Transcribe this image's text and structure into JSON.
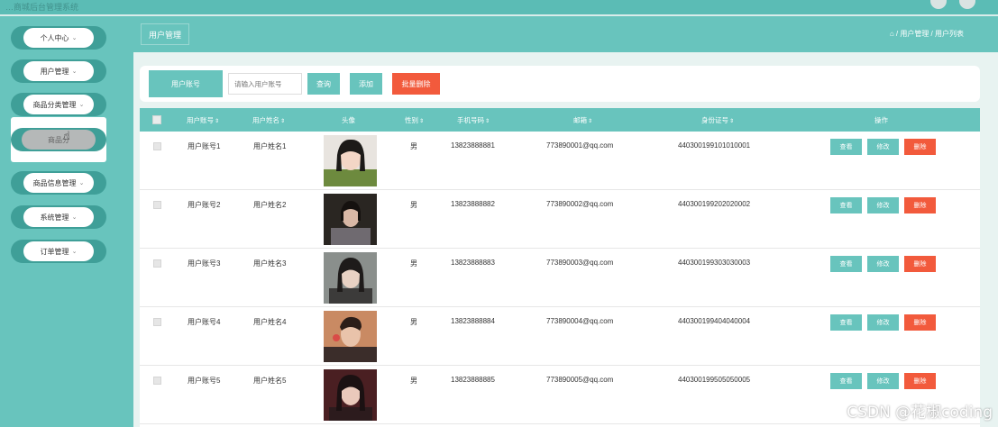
{
  "window": {
    "title": "…商城后台管理系统"
  },
  "sidebar": {
    "items": [
      {
        "label": "个人中心"
      },
      {
        "label": "用户管理"
      },
      {
        "label": "商品分类管理"
      },
      {
        "label": "商品信息管理"
      },
      {
        "label": "系统管理"
      },
      {
        "label": "订单管理"
      }
    ],
    "submenu": {
      "label": "商品分"
    }
  },
  "header": {
    "tab": "用户管理",
    "breadcrumb": "⌂ / 用户管理 / 用户列表"
  },
  "search": {
    "field_label": "用户账号",
    "placeholder": "请输入用户账号",
    "query_button": "查询",
    "add_button": "添加",
    "batch_delete_button": "批量删除"
  },
  "table": {
    "columns": [
      "用户账号",
      "用户姓名",
      "头像",
      "性别",
      "手机号码",
      "邮箱",
      "身份证号",
      "操作"
    ],
    "rows": [
      {
        "account": "用户账号1",
        "name": "用户姓名1",
        "gender": "男",
        "phone": "13823888881",
        "email": "773890001@qq.com",
        "id_card": "440300199101010001"
      },
      {
        "account": "用户账号2",
        "name": "用户姓名2",
        "gender": "男",
        "phone": "13823888882",
        "email": "773890002@qq.com",
        "id_card": "440300199202020002"
      },
      {
        "account": "用户账号3",
        "name": "用户姓名3",
        "gender": "男",
        "phone": "13823888883",
        "email": "773890003@qq.com",
        "id_card": "440300199303030003"
      },
      {
        "account": "用户账号4",
        "name": "用户姓名4",
        "gender": "男",
        "phone": "13823888884",
        "email": "773890004@qq.com",
        "id_card": "440300199404040004"
      },
      {
        "account": "用户账号5",
        "name": "用户姓名5",
        "gender": "男",
        "phone": "13823888885",
        "email": "773890005@qq.com",
        "id_card": "440300199505050005"
      }
    ],
    "actions": {
      "view": "查看",
      "edit": "修改",
      "delete": "删除"
    }
  },
  "watermark": "CSDN @花椒coding",
  "colors": {
    "accent": "#68c4bd",
    "accent_dark": "#3f9f98",
    "danger": "#f25a3c"
  }
}
